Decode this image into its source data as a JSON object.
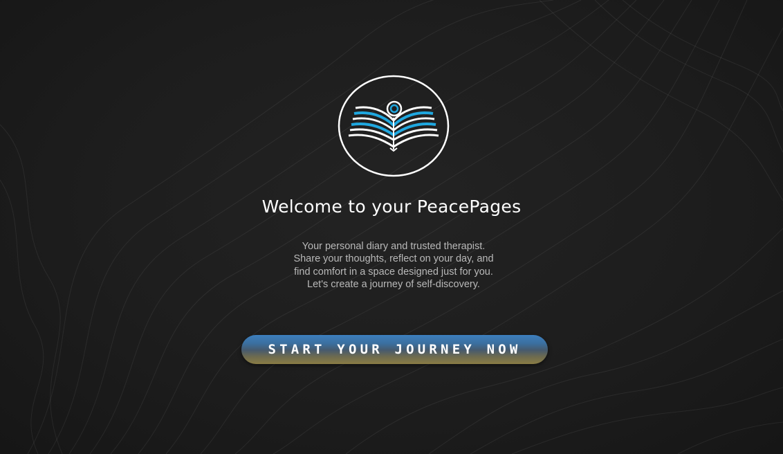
{
  "welcome": {
    "logo_name": "open-book-reader-logo",
    "title": "Welcome to your PeacePages",
    "description": "Your personal diary and trusted therapist. Share your thoughts, reflect on your day, and find comfort in a space designed just for you. Let's create a journey of self-discovery.",
    "cta_label": "START YOUR JOURNEY NOW"
  },
  "colors": {
    "background": "#1c1c1c",
    "accent_blue": "#1fa8e0",
    "button_top": "#3d7fbe",
    "button_bottom": "#8a7c45",
    "text_primary": "#ffffff",
    "text_secondary": "#b9b9b9"
  }
}
